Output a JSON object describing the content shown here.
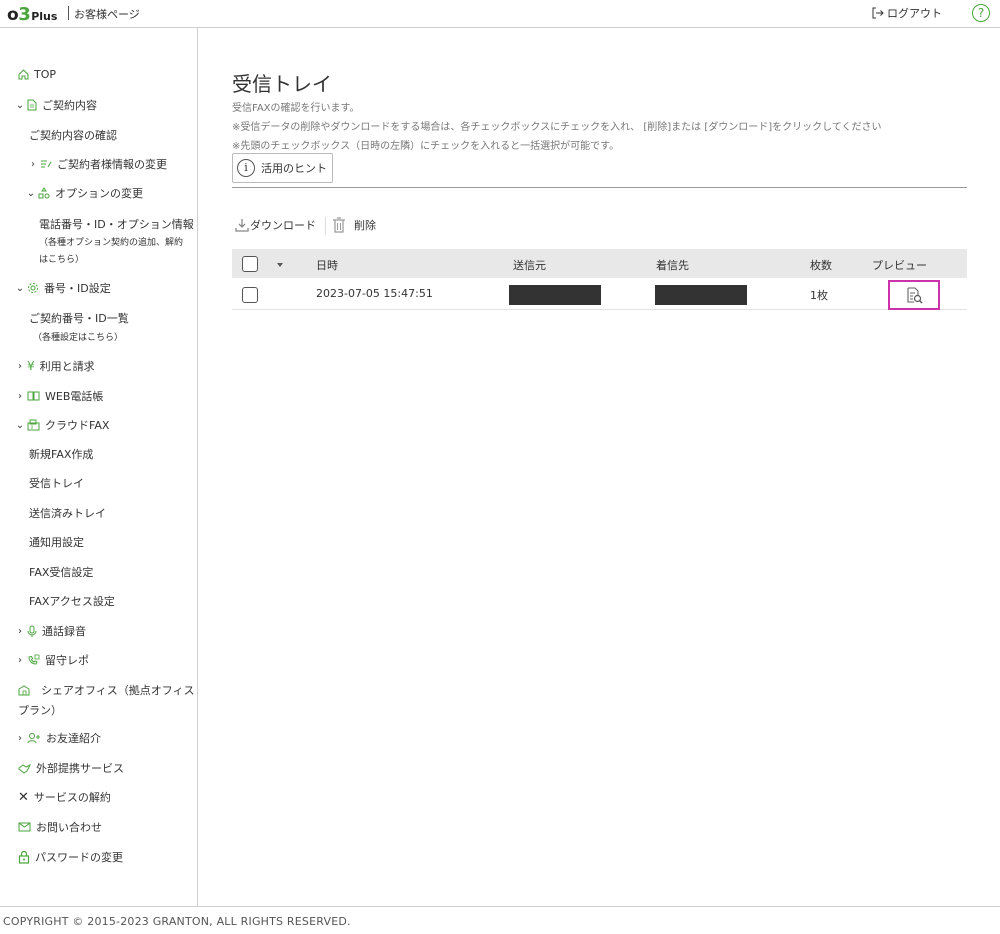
{
  "header": {
    "logo_o": "o",
    "logo_3": "3",
    "logo_plus": "Plus",
    "subtitle": "お客様ページ",
    "logout_label": "ログアウト",
    "help_label": "?"
  },
  "sidebar": {
    "top": "TOP",
    "contract": "ご契約内容",
    "contract_check": "ご契約内容の確認",
    "contract_change": "ご契約者様情報の変更",
    "option_change": "オプションの変更",
    "phone_option_info": "電話番号・ID・オプション情報",
    "phone_option_note1": "（各種オプション契約の追加、解約",
    "phone_option_note2": "はこちら）",
    "number_id_settings": "番号・ID設定",
    "number_list": "ご契約番号・ID一覧",
    "number_list_note": "（各種設定はこちら）",
    "billing": "利用と請求",
    "web_phonebook": "WEB電話帳",
    "cloud_fax": "クラウドFAX",
    "new_fax": "新規FAX作成",
    "inbox": "受信トレイ",
    "sent": "送信済みトレイ",
    "notify": "通知用設定",
    "fax_receive": "FAX受信設定",
    "fax_access": "FAXアクセス設定",
    "call_record": "通話録音",
    "voicemail": "留守レポ",
    "share_office1": "シェアオフィス（拠点オフィス",
    "share_office2": "プラン）",
    "referral": "お友達紹介",
    "external": "外部提携サービス",
    "cancel": "サービスの解約",
    "contact": "お問い合わせ",
    "password": "パスワードの変更"
  },
  "main": {
    "title": "受信トレイ",
    "desc1": "受信FAXの確認を行います。",
    "desc2": "※受信データの削除やダウンロードをする場合は、各チェックボックスにチェックを入れ、 [削除]または [ダウンロード]をクリックしてください",
    "desc3": "※先頭のチェックボックス（日時の左隣）にチェックを入れると一括選択が可能です。",
    "hint_label": "活用のヒント",
    "hint_icon": "i",
    "download_label": "ダウンロード",
    "delete_label": "削除",
    "columns": {
      "datetime": "日時",
      "sender": "送信元",
      "recipient": "着信先",
      "pages": "枚数",
      "preview": "プレビュー"
    },
    "rows": [
      {
        "datetime": "2023-07-05 15:47:51",
        "sender": "",
        "recipient": "",
        "pages": "1枚"
      }
    ]
  },
  "footer": {
    "copyright": "COPYRIGHT © 2015-2023 GRANTON, ALL RIGHTS RESERVED."
  },
  "colors": {
    "accent": "#4aa63c",
    "highlight": "#cc33aa",
    "table_header": "#e8e8e8"
  }
}
